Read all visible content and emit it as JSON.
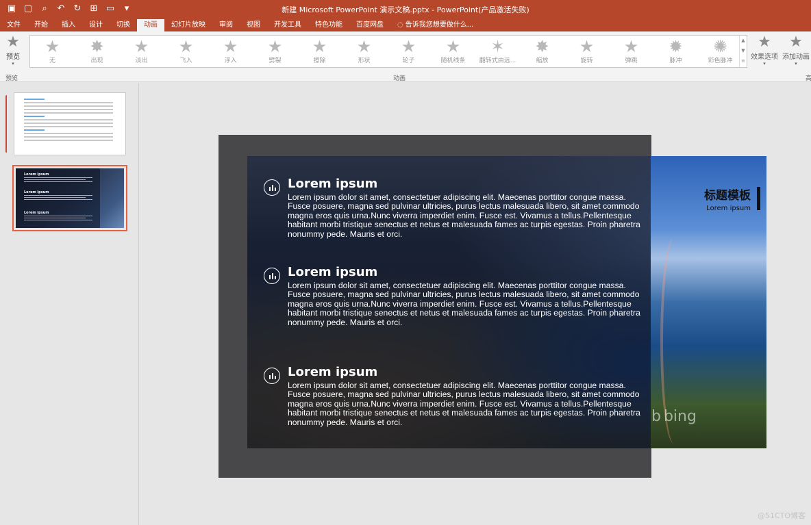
{
  "window": {
    "title": "新建 Microsoft PowerPoint 演示文稿.pptx - PowerPoint(产品激活失败)"
  },
  "qat": [
    "save-icon",
    "new-icon",
    "print-preview-icon",
    "undo-icon",
    "redo-icon",
    "present-icon",
    "open-icon",
    "customize-icon"
  ],
  "tabs": [
    "文件",
    "开始",
    "插入",
    "设计",
    "切换",
    "动画",
    "幻灯片放映",
    "审阅",
    "视图",
    "开发工具",
    "特色功能",
    "百度网盘"
  ],
  "active_tab": "动画",
  "tell_me": "告诉我您想要做什么...",
  "ribbon": {
    "preview_label": "预览",
    "preview_group": "预览",
    "animations": [
      "无",
      "出现",
      "淡出",
      "飞入",
      "浮入",
      "劈裂",
      "擦除",
      "形状",
      "轮子",
      "随机线条",
      "翻转式由远...",
      "缩放",
      "旋转",
      "弹跳",
      "脉冲",
      "彩色脉冲"
    ],
    "animation_group": "动画",
    "effect_options": "效果选项",
    "add_animation": "添加动画",
    "advanced_group_partial": "高"
  },
  "slide": {
    "sections": [
      {
        "title": "Lorem ipsum",
        "body": "Lorem ipsum dolor sit amet, consectetuer adipiscing elit. Maecenas porttitor congue massa. Fusce posuere, magna sed pulvinar ultricies, purus lectus malesuada libero, sit amet commodo magna eros quis urna.Nunc viverra imperdiet enim. Fusce est. Vivamus a tellus.Pellentesque habitant morbi tristique senectus et netus et malesuada fames ac turpis egestas. Proin pharetra nonummy pede. Mauris et orci."
      },
      {
        "title": "Lorem ipsum",
        "body": "Lorem ipsum dolor sit amet, consectetuer adipiscing elit. Maecenas porttitor congue massa. Fusce posuere, magna sed pulvinar ultricies, purus lectus malesuada libero, sit amet commodo magna eros quis urna.Nunc viverra imperdiet enim. Fusce est. Vivamus a tellus.Pellentesque habitant morbi tristique senectus et netus et malesuada fames ac turpis egestas. Proin pharetra nonummy pede. Mauris et orci."
      },
      {
        "title": "Lorem ipsum",
        "body": "Lorem ipsum dolor sit amet, consectetuer adipiscing elit. Maecenas porttitor congue massa. Fusce posuere, magna sed pulvinar ultricies, purus lectus malesuada libero, sit amet commodo magna eros quis urna.Nunc viverra imperdiet enim. Fusce est. Vivamus a tellus.Pellentesque habitant morbi tristique senectus et netus et malesuada fames ac turpis egestas. Proin pharetra nonummy pede. Mauris et orci."
      }
    ],
    "heading": "标题模板",
    "subheading": "Lorem ipsum",
    "bing": "bing"
  },
  "thumb2": {
    "label": "Lorem ipsum"
  },
  "watermark": "@51CTO博客",
  "colors": {
    "accent": "#b7472a",
    "thumb_selected": "#e8603f"
  }
}
